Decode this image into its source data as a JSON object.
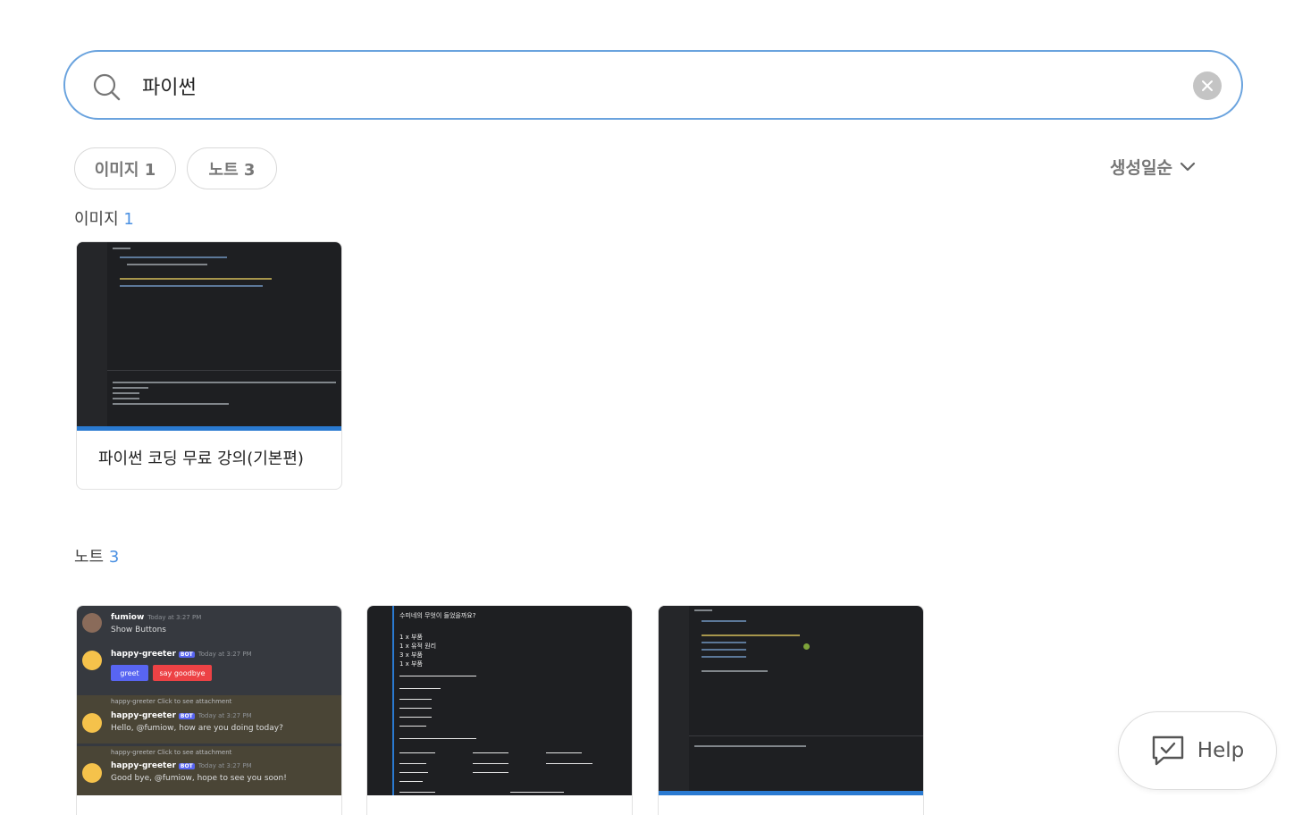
{
  "search": {
    "value": "파이썬"
  },
  "filters": [
    {
      "label": "이미지 1"
    },
    {
      "label": "노트 3"
    }
  ],
  "sort": {
    "label": "생성일순"
  },
  "images_section": {
    "title": "이미지",
    "count": "1"
  },
  "image_cards": [
    {
      "title": "파이썬 코딩 무료 강의(기본편)"
    }
  ],
  "notes_section": {
    "title": "노트",
    "count": "3"
  },
  "note_discord": {
    "messages": [
      {
        "user": "fumiow",
        "time": "Today at 3:27 PM",
        "text": "Show Buttons"
      },
      {
        "user": "happy-greeter",
        "badge": "BOT",
        "time": "Today at 3:27 PM"
      },
      {
        "reply": "happy-greeter Click to see attachment",
        "user": "happy-greeter",
        "badge": "BOT",
        "time": "Today at 3:27 PM",
        "text": "Hello, @fumiow, how are you doing today?"
      },
      {
        "reply": "happy-greeter Click to see attachment",
        "user": "happy-greeter",
        "badge": "BOT",
        "time": "Today at 3:27 PM",
        "text": "Good bye, @fumiow, hope to see you soon!"
      }
    ],
    "buttons": [
      "greet",
      "say goodbye"
    ]
  },
  "note_text": {
    "header": "수미네의 무엇이 들었을까요?",
    "lines": [
      "1 x 부품",
      "1 x 유적 원리",
      "3 x 부품",
      "1 x 부품"
    ]
  },
  "help": {
    "label": "Help"
  },
  "colors": {
    "accent": "#4a90e2",
    "search_border": "#6aa3de",
    "chip_text": "#777777"
  }
}
